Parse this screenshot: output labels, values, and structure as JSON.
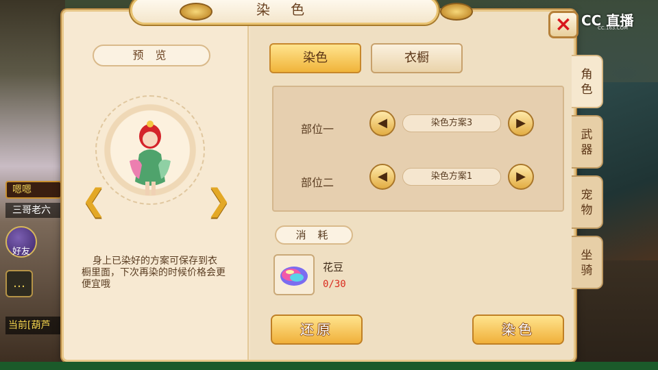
{
  "window": {
    "title": "染 色",
    "close_icon": "×"
  },
  "watermark": {
    "text": "CC 直播",
    "sub": "CC.163.COM"
  },
  "preview": {
    "label": "预 览",
    "description": "身上已染好的方案可保存到衣橱里面，下次再染的时候价格会更便宜哦"
  },
  "tabs": {
    "dye": "染色",
    "wardrobe": "衣橱"
  },
  "dye": {
    "slots": [
      {
        "label": "部位一",
        "value": "染色方案3"
      },
      {
        "label": "部位二",
        "value": "染色方案1"
      }
    ]
  },
  "cost": {
    "label": "消 耗",
    "item_name": "花豆",
    "item_count": "0/30"
  },
  "actions": {
    "reset": "还原",
    "dye": "染色"
  },
  "side_tabs": [
    {
      "label": "角\n色",
      "active": true
    },
    {
      "label": "武\n器",
      "active": false
    },
    {
      "label": "宠\n物",
      "active": false
    },
    {
      "label": "坐\n骑",
      "active": false
    }
  ],
  "hud": {
    "mute": "嗯嗯",
    "player": "三哥老六",
    "friends": "好友",
    "current_channel": "当前",
    "current_text": "[葫芦"
  },
  "colors": {
    "accent": "#f0b43a",
    "panel": "#f3e2c6",
    "count_red": "#d92a1e"
  }
}
